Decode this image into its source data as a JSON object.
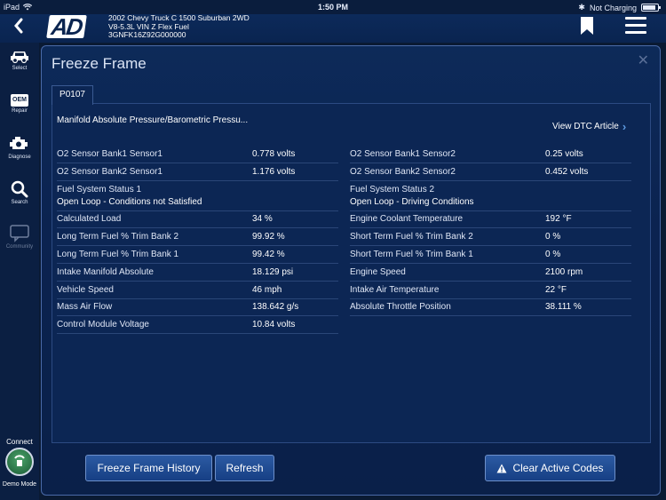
{
  "status_bar": {
    "device": "iPad",
    "time": "1:50 PM",
    "charging": "Not Charging",
    "battery_level": 0.9
  },
  "header": {
    "logo": "AD",
    "vehicle_line1": "2002 Chevy Truck C 1500 Suburban 2WD",
    "vehicle_line2": "V8-5.3L VIN Z Flex Fuel",
    "vin": "3GNFK16Z92G000000"
  },
  "sidebar": {
    "items": [
      {
        "label": "Select",
        "icon": "car-icon"
      },
      {
        "label": "Repair",
        "icon": "oem-icon",
        "icon_text": "OEM"
      },
      {
        "label": "Diagnose",
        "icon": "engine-icon"
      },
      {
        "label": "Search",
        "icon": "search-icon"
      },
      {
        "label": "Community",
        "icon": "chat-icon"
      }
    ],
    "connect_label": "Connect",
    "demo_label": "Demo Mode"
  },
  "panel": {
    "title": "Freeze Frame",
    "tab": "P0107",
    "dtc_description": "Manifold Absolute Pressure/Barometric Pressu...",
    "dtc_link": "View DTC Article"
  },
  "left_rows": [
    {
      "label": "O2 Sensor Bank1 Sensor1",
      "value": "0.778 volts"
    },
    {
      "label": "O2 Sensor Bank2 Sensor1",
      "value": "1.176 volts"
    },
    {
      "label": "Fuel System Status 1",
      "value": "Open Loop - Conditions not Satisfied",
      "tall": true
    },
    {
      "label": "Calculated Load",
      "value": "34 %"
    },
    {
      "label": "Long Term Fuel % Trim Bank 2",
      "value": "99.92 %"
    },
    {
      "label": "Long Term Fuel % Trim Bank 1",
      "value": "99.42 %"
    },
    {
      "label": "Intake Manifold Absolute",
      "value": "18.129 psi"
    },
    {
      "label": "Vehicle Speed",
      "value": "46 mph"
    },
    {
      "label": "Mass Air Flow",
      "value": "138.642 g/s"
    },
    {
      "label": "Control Module Voltage",
      "value": "10.84 volts"
    }
  ],
  "right_rows": [
    {
      "label": "O2 Sensor Bank1 Sensor2",
      "value": "0.25 volts"
    },
    {
      "label": "O2 Sensor Bank2 Sensor2",
      "value": "0.452 volts"
    },
    {
      "label": "Fuel System Status 2",
      "value": "Open Loop - Driving Conditions",
      "tall": true
    },
    {
      "label": "Engine Coolant Temperature",
      "value": "192 °F"
    },
    {
      "label": "Short Term Fuel % Trim Bank 2",
      "value": "0 %"
    },
    {
      "label": "Short Term Fuel % Trim Bank 1",
      "value": "0 %"
    },
    {
      "label": "Engine Speed",
      "value": "2100 rpm"
    },
    {
      "label": "Intake Air Temperature",
      "value": "22 °F"
    },
    {
      "label": "Absolute Throttle Position",
      "value": "38.111 %"
    }
  ],
  "buttons": {
    "history": "Freeze Frame History",
    "refresh": "Refresh",
    "clear": "Clear Active Codes"
  },
  "colors": {
    "accent": "#5d9ae0",
    "panel_bg": "#0b2350",
    "button_bg": "#1f4d95"
  }
}
